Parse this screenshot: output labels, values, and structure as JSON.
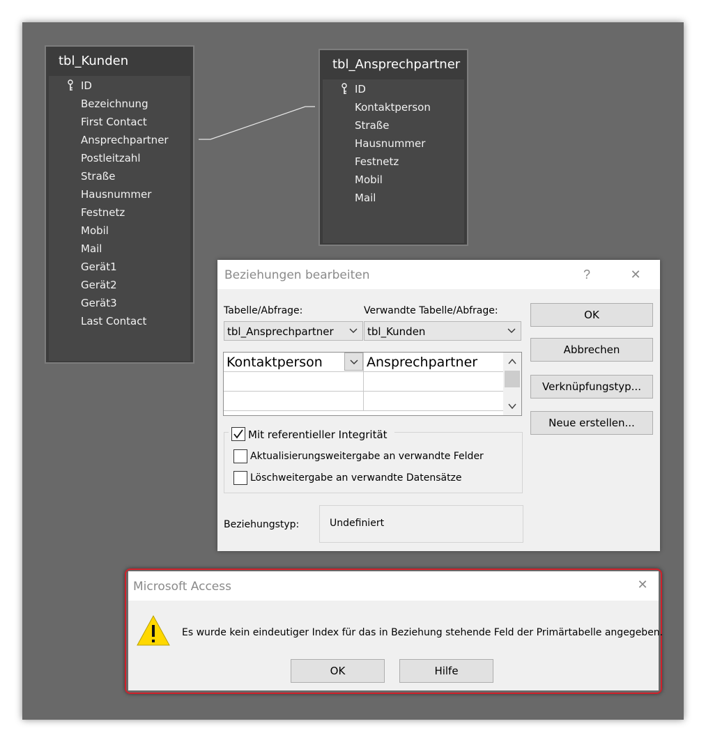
{
  "tables": {
    "kunden": {
      "title": "tbl_Kunden",
      "fields": [
        "ID",
        "Bezeichnung",
        "First Contact",
        "Ansprechpartner",
        "Postleitzahl",
        "Straße",
        "Hausnummer",
        "Festnetz",
        "Mobil",
        "Mail",
        "Gerät1",
        "Gerät2",
        "Gerät3",
        "Last Contact"
      ]
    },
    "ansprechpartner": {
      "title": "tbl_Ansprechpartner",
      "fields": [
        "ID",
        "Kontaktperson",
        "Straße",
        "Hausnummer",
        "Festnetz",
        "Mobil",
        "Mail"
      ]
    }
  },
  "relation_dialog": {
    "title": "Beziehungen bearbeiten",
    "help_glyph": "?",
    "close_glyph": "✕",
    "table_label": "Tabelle/Abfrage:",
    "related_label": "Verwandte Tabelle/Abfrage:",
    "table_value": "tbl_Ansprechpartner",
    "related_value": "tbl_Kunden",
    "grid": {
      "left_field": "Kontaktperson",
      "right_field": "Ansprechpartner"
    },
    "buttons": {
      "ok": "OK",
      "cancel": "Abbrechen",
      "join_type": "Verknüpfungstyp...",
      "create_new": "Neue erstellen..."
    },
    "checkboxes": {
      "referential": {
        "label": "Mit referentieller Integrität",
        "checked": true
      },
      "cascade_update": {
        "label": "Aktualisierungsweitergabe an verwandte Felder",
        "checked": false
      },
      "cascade_delete": {
        "label": "Löschweitergabe an verwandte Datensätze",
        "checked": false
      }
    },
    "relation_type_label": "Beziehungstyp:",
    "relation_type_value": "Undefiniert"
  },
  "message_box": {
    "title": "Microsoft Access",
    "close_glyph": "✕",
    "icon": "warning-icon",
    "message": "Es wurde kein eindeutiger Index für das in Beziehung stehende Feld der Primärtabelle angegeben.",
    "ok_label": "OK",
    "help_label": "Hilfe"
  },
  "colors": {
    "background": "#696969",
    "highlight": "#d0202a",
    "warning": "#ffd800"
  }
}
